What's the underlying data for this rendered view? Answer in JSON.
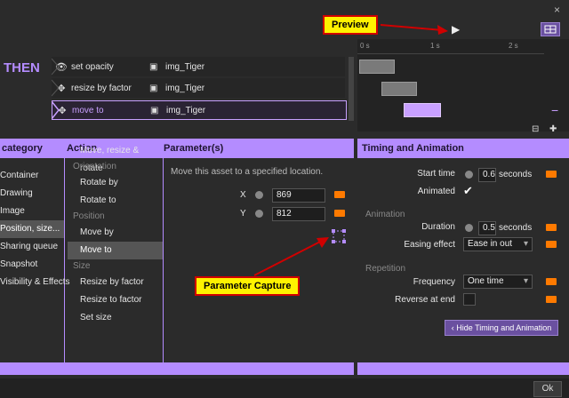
{
  "header": {
    "close": "×"
  },
  "rules": {
    "then_label": "THEN",
    "rows": [
      {
        "label": "set opacity",
        "asset": "img_Tiger",
        "icon": "eye-icon"
      },
      {
        "label": "resize by factor",
        "asset": "img_Tiger",
        "icon": "move-icon"
      },
      {
        "label": "move to",
        "asset": "img_Tiger",
        "icon": "move-icon"
      }
    ]
  },
  "timeline": {
    "ticks": [
      "0 s",
      "1 s",
      "2 s"
    ]
  },
  "annotations": {
    "preview": "Preview",
    "parameter_capture": "Parameter Capture"
  },
  "panels": {
    "category_header": "category",
    "action_header": "Action",
    "parameters_header": "Parameter(s)",
    "timing_header": "Timing and Animation"
  },
  "categories": [
    "Container",
    "Drawing",
    "Image",
    "Position, size...",
    "Sharing queue",
    "Snapshot",
    "Visibility & Effects"
  ],
  "actions": {
    "top": "Move, resize & rotate",
    "orientation_label": "Orientation",
    "orientation": [
      "Rotate by",
      "Rotate to"
    ],
    "position_label": "Position",
    "position": [
      "Move by",
      "Move to"
    ],
    "size_label": "Size",
    "size": [
      "Resize by factor",
      "Resize to factor",
      "Set size"
    ]
  },
  "parameters": {
    "description": "Move this asset to a specified location.",
    "x_label": "X",
    "x_value": "869",
    "y_label": "Y",
    "y_value": "812"
  },
  "timing": {
    "start_time_label": "Start time",
    "start_time_value": "0.6",
    "start_time_unit": "seconds",
    "animated_label": "Animated",
    "animation_section": "Animation",
    "duration_label": "Duration",
    "duration_value": "0.5",
    "duration_unit": "seconds",
    "easing_label": "Easing effect",
    "easing_value": "Ease in out",
    "repetition_section": "Repetition",
    "frequency_label": "Frequency",
    "frequency_value": "One time",
    "reverse_label": "Reverse at end",
    "hide_button": "Hide Timing and Animation"
  },
  "footer": {
    "ok": "Ok"
  },
  "colors": {
    "accent": "#b48cff",
    "keyframe": "#ff7a00",
    "callout": "#fff200",
    "callout_border": "#d00000"
  }
}
